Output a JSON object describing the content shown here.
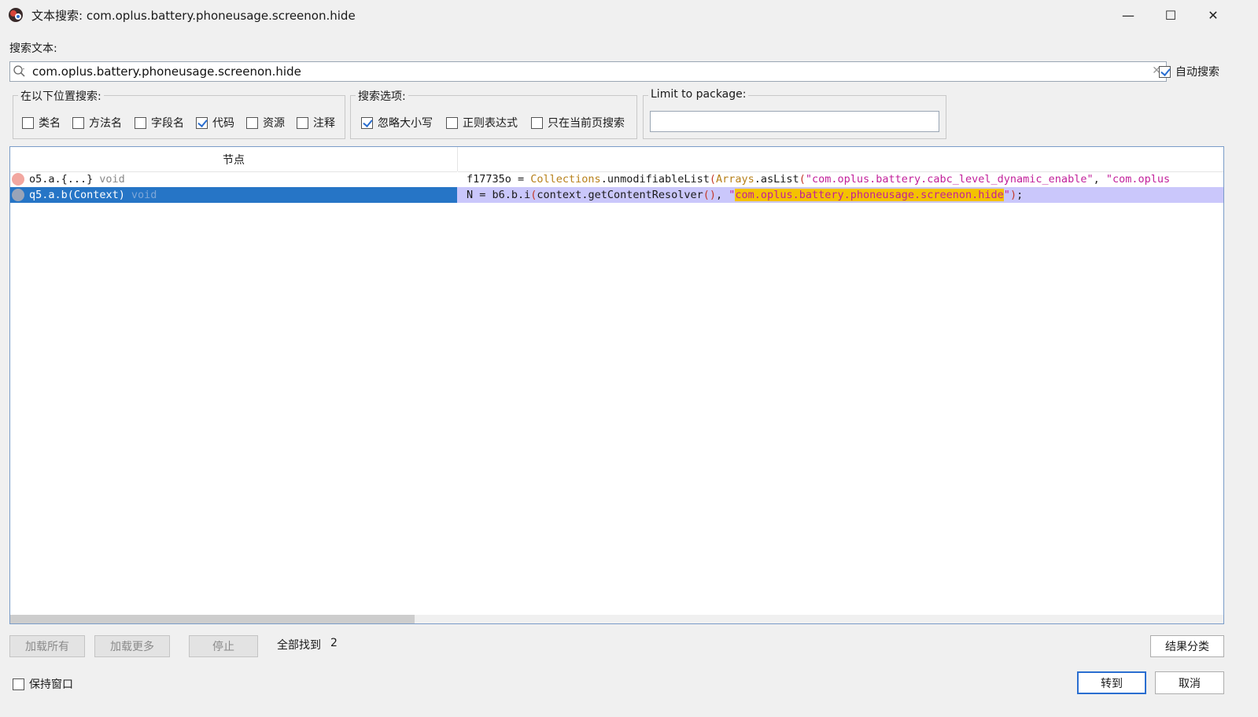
{
  "window": {
    "title": "文本搜索: com.oplus.battery.phoneusage.screenon.hide",
    "minimize": "—",
    "maximize": "☐",
    "close": "✕"
  },
  "search": {
    "label": "搜索文本:",
    "value": "com.oplus.battery.phoneusage.screenon.hide",
    "auto_search_label": "自动搜索",
    "auto_search_checked": true
  },
  "search_in": {
    "title": "在以下位置搜索:",
    "options": [
      {
        "label": "类名",
        "checked": false
      },
      {
        "label": "方法名",
        "checked": false
      },
      {
        "label": "字段名",
        "checked": false
      },
      {
        "label": "代码",
        "checked": true
      },
      {
        "label": "资源",
        "checked": false
      },
      {
        "label": "注释",
        "checked": false
      }
    ]
  },
  "search_options": {
    "title": "搜索选项:",
    "options": [
      {
        "label": "忽略大小写",
        "checked": true
      },
      {
        "label": "正则表达式",
        "checked": false
      },
      {
        "label": "只在当前页搜索",
        "checked": false
      }
    ]
  },
  "package": {
    "title": "Limit to package:",
    "value": ""
  },
  "results": {
    "column_node": "节点",
    "column_code": "",
    "rows": [
      {
        "node": "o5.a.{...}",
        "return_type": "void",
        "icon": "field-icon",
        "selected": false,
        "code": [
          {
            "t": "f17735o = ",
            "c": ""
          },
          {
            "t": "Collections",
            "c": "cls"
          },
          {
            "t": ".unmodifiableList",
            "c": ""
          },
          {
            "t": "(",
            "c": "paren"
          },
          {
            "t": "Arrays",
            "c": "cls"
          },
          {
            "t": ".asList",
            "c": ""
          },
          {
            "t": "(",
            "c": "paren"
          },
          {
            "t": "\"com.oplus.battery.cabc_level_dynamic_enable\"",
            "c": "str"
          },
          {
            "t": ", ",
            "c": ""
          },
          {
            "t": "\"com.oplus",
            "c": "str"
          }
        ]
      },
      {
        "node": "q5.a.b(Context)",
        "return_type": "void",
        "icon": "method-icon",
        "selected": true,
        "code": [
          {
            "t": "N = b6.b.i",
            "c": ""
          },
          {
            "t": "(",
            "c": "paren"
          },
          {
            "t": "context.getContentResolver",
            "c": ""
          },
          {
            "t": "()",
            "c": "paren"
          },
          {
            "t": ", ",
            "c": ""
          },
          {
            "t": "\"",
            "c": "str"
          },
          {
            "t": "com.oplus.battery.phoneusage.screenon.hide",
            "c": "hl"
          },
          {
            "t": "\"",
            "c": "str"
          },
          {
            "t": ")",
            "c": "paren"
          },
          {
            "t": ";",
            "c": ""
          }
        ]
      }
    ],
    "scroll_position": 0.0
  },
  "footer": {
    "load_all": "加载所有",
    "load_more": "加载更多",
    "stop": "停止",
    "found_label": "全部找到",
    "found_count": "2",
    "group_results": "结果分类",
    "keep_window_label": "保持窗口",
    "keep_window_checked": false,
    "goto": "转到",
    "cancel": "取消"
  },
  "colors": {
    "selection": "#2675c6",
    "code_selection": "#cac7fb",
    "highlight": "#f4c200",
    "string": "#c21f9a",
    "class": "#b7801a"
  }
}
